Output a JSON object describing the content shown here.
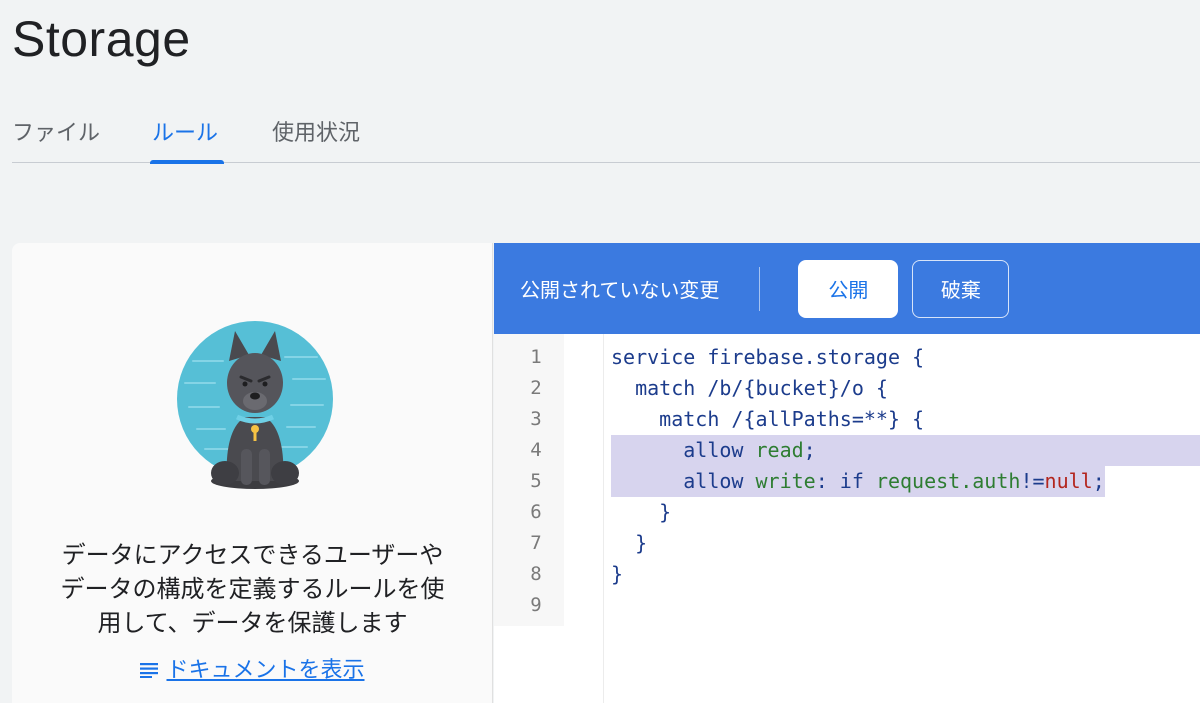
{
  "page": {
    "title": "Storage"
  },
  "tabs": [
    {
      "label": "ファイル",
      "active": false
    },
    {
      "label": "ルール",
      "active": true
    },
    {
      "label": "使用状況",
      "active": false
    }
  ],
  "intro": {
    "description_lines": [
      "データにアクセスできるユーザーや",
      "データの構成を定義するルールを使",
      "用して、データを保護します"
    ],
    "doc_link_label": "ドキュメントを表示",
    "doc_link_icon": "list-icon",
    "illustration": "dog-guard-illustration"
  },
  "toolbar": {
    "status": "公開されていない変更",
    "publish_label": "公開",
    "discard_label": "破棄"
  },
  "editor": {
    "line_numbers": [
      "1",
      "2",
      "3",
      "4",
      "5",
      "6",
      "7",
      "8",
      "9"
    ],
    "lines": [
      "service firebase.storage {",
      "  match /b/{bucket}/o {",
      "    match /{allPaths=**} {",
      "      allow read;",
      "      allow write: if request.auth!=null;",
      "    }",
      "  }",
      "}",
      ""
    ]
  },
  "colors": {
    "accent": "#1a73e8",
    "toolbar": "#3b7ae0",
    "highlight": "#d7d4ee"
  }
}
